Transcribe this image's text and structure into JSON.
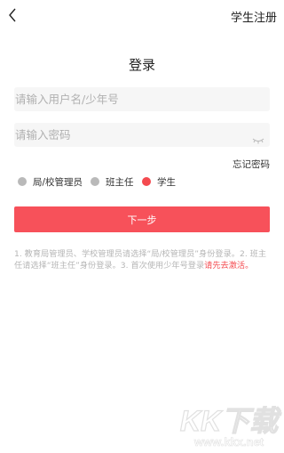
{
  "header": {
    "back_icon": "back-chevron-icon",
    "register_label": "学生注册"
  },
  "page": {
    "title": "登录"
  },
  "form": {
    "username_placeholder": "请输入用户名/少年号",
    "password_placeholder": "请输入密码",
    "password_toggle_icon": "eye-closed-icon",
    "forgot_label": "忘记密码"
  },
  "roles": [
    {
      "label": "局/校管理员",
      "selected": false
    },
    {
      "label": "班主任",
      "selected": false
    },
    {
      "label": "学生",
      "selected": true
    }
  ],
  "next_label": "下一步",
  "hint": {
    "text": "1. 教育局管理员、学校管理员请选择“局/校管理员”身份登录。2. 班主任请选择“班主任”身份登录。3. 首次使用少年号登录",
    "link": "请先去激活。"
  },
  "watermark": {
    "logo": "KK下载",
    "url": "www.kkx.net"
  },
  "colors": {
    "accent": "#f44a4f",
    "button": "#f7515a"
  }
}
